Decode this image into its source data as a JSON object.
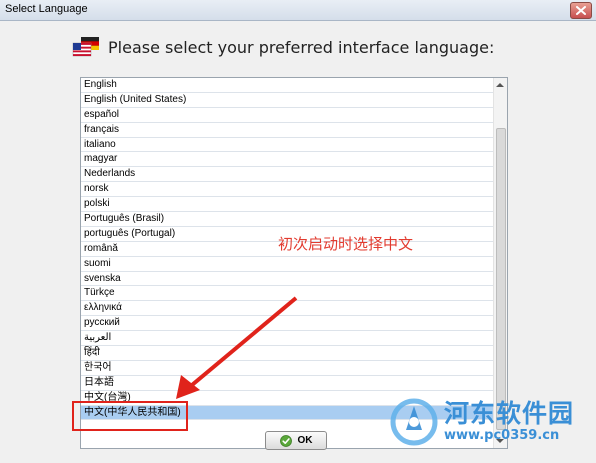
{
  "window": {
    "title": "Select Language",
    "close_icon": "close-icon",
    "close_color": "#c75050"
  },
  "header": {
    "flag_icon": "us-german-flags-icon",
    "text": "Please select your preferred interface language:"
  },
  "languages": [
    {
      "label": "English"
    },
    {
      "label": "English (United States)"
    },
    {
      "label": "español"
    },
    {
      "label": "français"
    },
    {
      "label": "italiano"
    },
    {
      "label": "magyar"
    },
    {
      "label": "Nederlands"
    },
    {
      "label": "norsk"
    },
    {
      "label": "polski"
    },
    {
      "label": "Português (Brasil)"
    },
    {
      "label": "português (Portugal)"
    },
    {
      "label": "română"
    },
    {
      "label": "suomi"
    },
    {
      "label": "svenska"
    },
    {
      "label": "Türkçe"
    },
    {
      "label": "ελληνικά"
    },
    {
      "label": "русский"
    },
    {
      "label": "العربية"
    },
    {
      "label": "हिंदी"
    },
    {
      "label": "한국어"
    },
    {
      "label": "日本語"
    },
    {
      "label": "中文(台灣)"
    },
    {
      "label": "中文(中华人民共和国)"
    }
  ],
  "selected_language": "中文(中华人民共和国)",
  "selection_color": "#a9cdf1",
  "ok_button": {
    "label": "OK",
    "icon": "check-icon"
  },
  "annotation": {
    "text": "初次启动时选择中文",
    "color": "#e0231b"
  },
  "watermark": {
    "name": "河东软件园",
    "url": "www.pc0359.cn",
    "color": "#3a8fd6"
  }
}
